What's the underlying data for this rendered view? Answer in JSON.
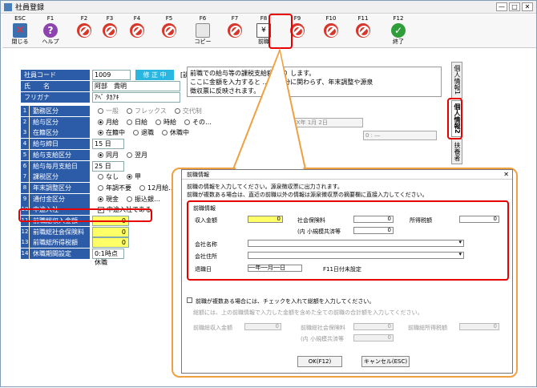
{
  "window": {
    "title": "社員登録",
    "min_glyph": "—",
    "max_glyph": "□",
    "close_glyph": "✕"
  },
  "fkeys": [
    {
      "key": "ESC",
      "label": "閉じる",
      "icon": "close-icon"
    },
    {
      "key": "F1",
      "label": "ヘルプ",
      "icon": "help-icon"
    },
    {
      "key": "F2",
      "label": "",
      "icon": "no-entry-icon"
    },
    {
      "key": "F3",
      "label": "",
      "icon": "no-entry-icon"
    },
    {
      "key": "F4",
      "label": "",
      "icon": "no-entry-icon"
    },
    {
      "key": "F5",
      "label": "",
      "icon": "no-entry-icon"
    },
    {
      "key": "F6",
      "label": "コピー",
      "icon": "copy-icon"
    },
    {
      "key": "F7",
      "label": "",
      "icon": "no-entry-icon"
    },
    {
      "key": "F8",
      "label": "前職",
      "icon": "yen-icon"
    },
    {
      "key": "F9",
      "label": "",
      "icon": "no-entry-icon"
    },
    {
      "key": "F10",
      "label": "",
      "icon": "no-entry-icon"
    },
    {
      "key": "F11",
      "label": "",
      "icon": "no-entry-icon"
    },
    {
      "key": "F12",
      "label": "終了",
      "icon": "ok-icon"
    }
  ],
  "icon_glyphs": {
    "help": "?",
    "yen": "¥",
    "ok": "✓"
  },
  "header": {
    "emp_code_label": "社員コード",
    "emp_code": "1009",
    "mode_badge": "修 正 中",
    "memo_label": "[説明]",
    "name_label": "氏　　名",
    "name_value": "阿部　貴明",
    "furigana_label": "フリガナ",
    "furigana_value": "ｱﾍﾞ ﾀｶｱｷ"
  },
  "memo": {
    "line1": "前職での給与等の課税支給額… り します。",
    "line2": "ここに金額を入力すると … の区分に関わらず、年末調整や源泉",
    "line3": "徴収票に反映されます。"
  },
  "fields": [
    {
      "num": "1",
      "label": "勤務区分",
      "options": [
        "一般",
        "フレックス",
        "交代制"
      ],
      "dim": true
    },
    {
      "num": "2",
      "label": "給与区分",
      "options": [
        "月給",
        "日給",
        "時給",
        "その…"
      ],
      "selected": 0
    },
    {
      "num": "3",
      "label": "在籍区分",
      "options": [
        "在籍中",
        "退職",
        "休職中"
      ],
      "selected": 0
    },
    {
      "num": "4",
      "label": "給与締日",
      "value": "15 日"
    },
    {
      "num": "5",
      "label": "給与支給区分",
      "options": [
        "同月",
        "翌月"
      ],
      "selected": 0
    },
    {
      "num": "6",
      "label": "給与毎月支給日",
      "value": "25 日"
    },
    {
      "num": "7",
      "label": "課税区分",
      "options": [
        "なし",
        "甲"
      ],
      "selected": 1
    },
    {
      "num": "8",
      "label": "年末調整区分",
      "options": [
        "年調不要",
        "12月給…"
      ],
      "selected": -1
    },
    {
      "num": "9",
      "label": "通付金区分",
      "options": [
        "現金",
        "振込銀…"
      ],
      "selected": 0
    },
    {
      "num": "10",
      "label": "中途入社",
      "checkbox": "中途入社である",
      "checked": true
    },
    {
      "num": "11",
      "label": "前職総収入金額",
      "value": "0"
    },
    {
      "num": "12",
      "label": "前職総社会保険料",
      "value": "0"
    },
    {
      "num": "13",
      "label": "前職総所得税額",
      "value": "0"
    },
    {
      "num": "14",
      "label": "休職期間設定",
      "value": "0:1時点休職"
    }
  ],
  "date_box": "19XX年 1月 2日",
  "date_box2": "0 : ―",
  "side_tabs": [
    "個人情報1",
    "個人情報2",
    "扶養者"
  ],
  "dialog": {
    "title": "前職情報",
    "close_glyph": "✕",
    "desc1": "前職の情報を入力してください。源泉徴収票に出力されます。",
    "desc2": "前職が複数ある場合は、直近の前職以外の情報は源泉徴収票の摘要欄に直接入力してください。",
    "section": "前職情報",
    "income_label": "収入金額",
    "income": "0",
    "social_label": "社会保険料",
    "social": "0",
    "tax_label": "所得税額",
    "tax": "0",
    "small_label": "(内 小規模共済等",
    "small": "0",
    "company_label": "会社名称",
    "company": "",
    "address_label": "会社住所",
    "address": "",
    "retire_label": "退職日",
    "retire": "──年──月──日",
    "retire_hint": "F11日付未設定",
    "multi_check": "前職が複数ある場合には、チェックを入れて総額を入力してください。",
    "multi_desc": "総額には、上の前職情報で入力した金額を含めた全ての前職の合計額を入力してください。",
    "total_income_label": "前職総収入金額",
    "total_income": "0",
    "total_social_label": "前職総社会保険料",
    "total_social": "0",
    "total_small_label": "(内 小規模共済等",
    "total_small": "0",
    "total_tax_label": "前職総所得税額",
    "total_tax": "0",
    "ok_label": "OK(F12)",
    "cancel_label": "キャンセル(ESC)"
  },
  "colors": {
    "label_bg": "#2c5ca8",
    "highlight": "#e60000",
    "callout": "#f0a040",
    "input_yellow": "#ffff66"
  }
}
